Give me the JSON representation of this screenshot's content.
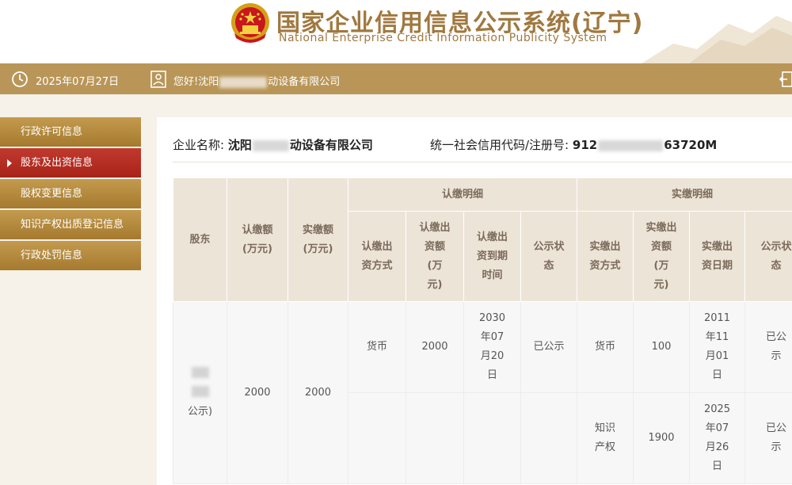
{
  "header": {
    "title": "国家企业信用信息公示系统(辽宁)",
    "subtitle": "National Enterprise Credit Information Publicity System"
  },
  "infobar": {
    "date": "2025年07月27日",
    "greeting_prefix": "您好!沈阳",
    "greeting_suffix": "动设备有限公司"
  },
  "sidebar": {
    "items": [
      {
        "label": "行政许可信息"
      },
      {
        "label": "股东及出资信息"
      },
      {
        "label": "股权变更信息"
      },
      {
        "label": "知识产权出质登记信息"
      },
      {
        "label": "行政处罚信息"
      }
    ]
  },
  "company": {
    "name_label": "企业名称:",
    "name_prefix": "沈阳",
    "name_suffix": "动设备有限公司",
    "credit_label": "统一社会信用代码/注册号:",
    "credit_prefix": "912",
    "credit_suffix": "63720M"
  },
  "table": {
    "group_headers": {
      "subscribed": "认缴明细",
      "paid": "实缴明细"
    },
    "columns": {
      "shareholder": "股东",
      "subscribed_amount": "认缴额\n(万元)",
      "paid_amount": "实缴额\n(万元)",
      "sub_method": "认缴出\n资方式",
      "sub_amount": "认缴出\n资额\n(万\n元)",
      "sub_date": "认缴出\n资到期\n时间",
      "sub_status": "公示状\n态",
      "paid_method": "实缴出\n资方式",
      "paid_amount_detail": "实缴出\n资额\n(万\n元)",
      "paid_date": "实缴出\n资日期",
      "paid_status": "公示状\n态"
    },
    "row": {
      "shareholder_suffix": "公示)",
      "subscribed_amount": "2000",
      "paid_amount": "2000",
      "subscribed": {
        "method": "货币",
        "amount": "2000",
        "date": "2030\n年07\n月20\n日",
        "status": "已公示"
      },
      "paid": [
        {
          "method": "货币",
          "amount": "100",
          "date": "2011\n年11\n月01\n日",
          "status": "已公\n示"
        },
        {
          "method": "知识\n产权",
          "amount": "1900",
          "date": "2025\n年07\n月26\n日",
          "status": "已公\n示"
        }
      ]
    }
  }
}
